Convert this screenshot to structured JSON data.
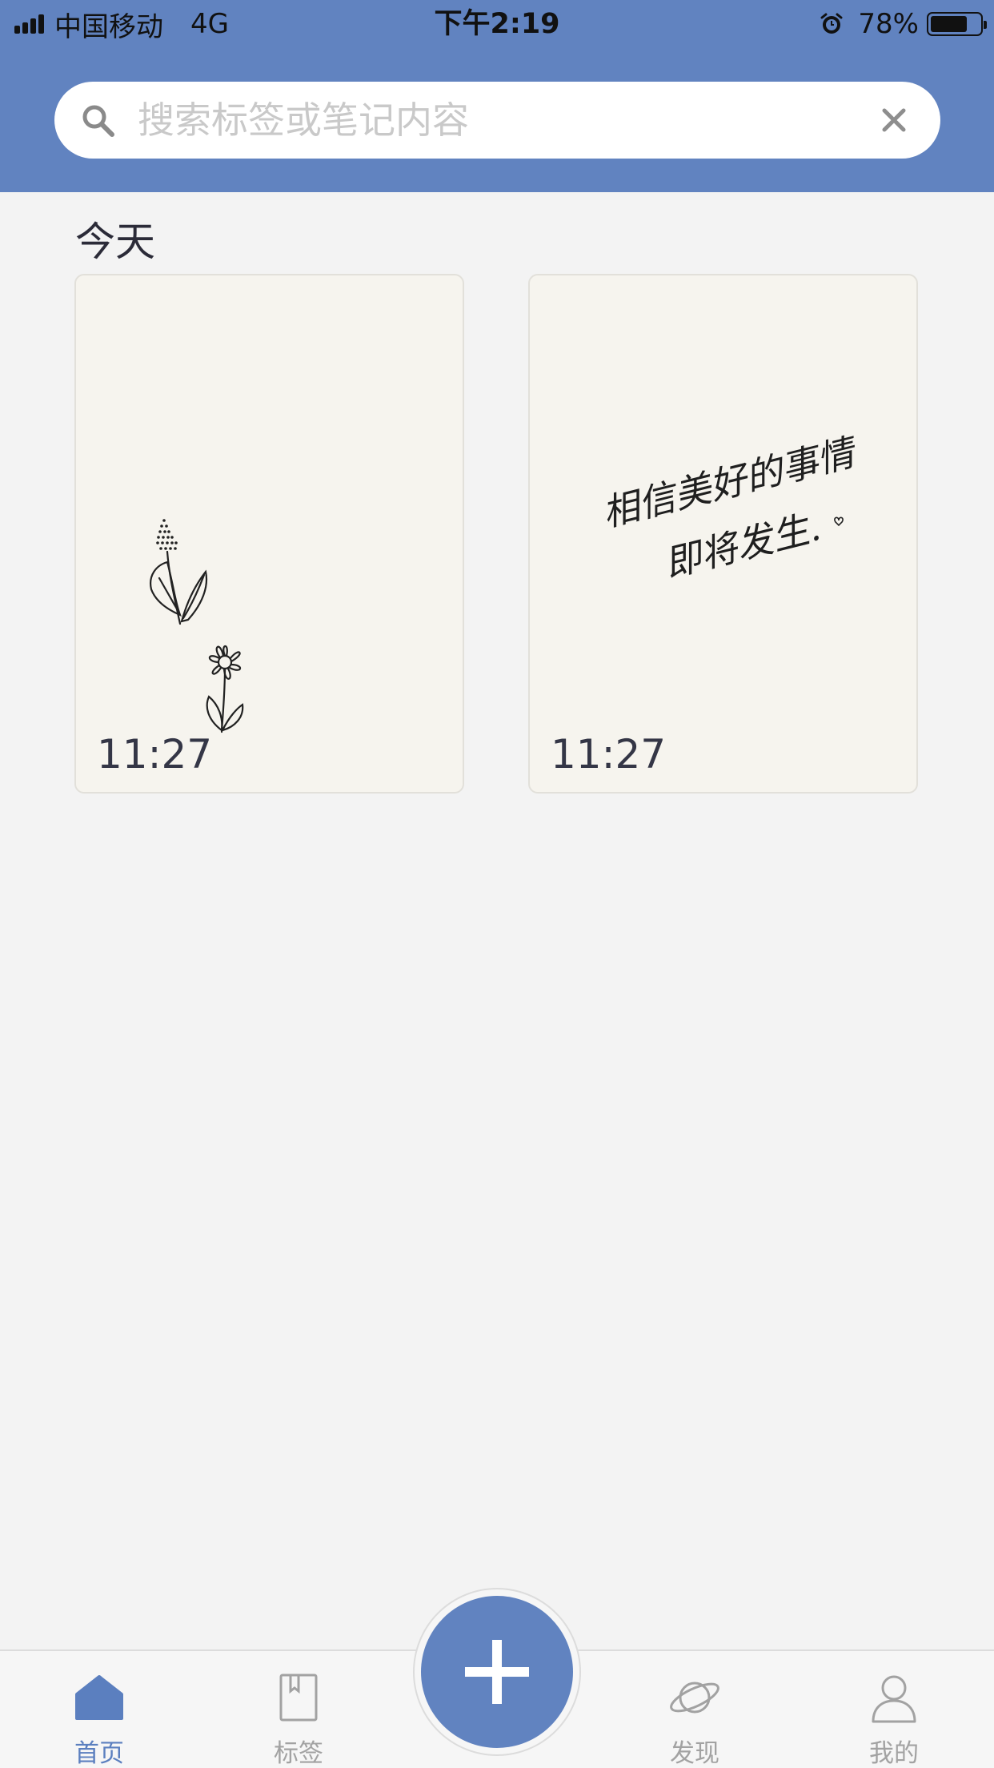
{
  "status_bar": {
    "carrier": "中国移动",
    "network": "4G",
    "time": "下午2:19",
    "battery_percent": "78%",
    "battery_level": 0.78
  },
  "search": {
    "placeholder": "搜索标签或笔记内容",
    "value": ""
  },
  "section": {
    "title": "今天"
  },
  "notes": [
    {
      "time": "11:27",
      "content_type": "flower-drawing"
    },
    {
      "time": "11:27",
      "content_type": "handwriting",
      "handwriting_lines": [
        "相信美好的事情",
        "即将发生."
      ]
    }
  ],
  "tabbar": {
    "items": [
      {
        "label": "首页",
        "icon": "home-icon",
        "active": true
      },
      {
        "label": "标签",
        "icon": "bookmark-icon",
        "active": false
      },
      {
        "label": "发现",
        "icon": "planet-icon",
        "active": false
      },
      {
        "label": "我的",
        "icon": "person-icon",
        "active": false
      }
    ],
    "add_icon": "plus-icon"
  },
  "colors": {
    "accent": "#6183c0",
    "background": "#f3f3f3",
    "card": "#f6f4ee",
    "inactive_tab": "#a2a2a2"
  }
}
